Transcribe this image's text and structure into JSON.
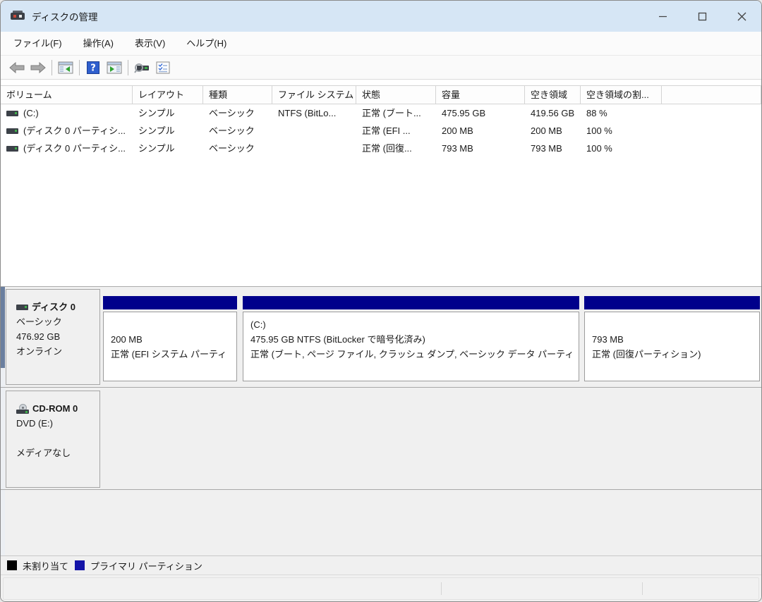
{
  "window": {
    "title": "ディスクの管理"
  },
  "menu": {
    "items": [
      "ファイル(F)",
      "操作(A)",
      "表示(V)",
      "ヘルプ(H)"
    ]
  },
  "toolbar": {
    "icons": [
      "back",
      "forward",
      "show-console-tree",
      "help",
      "show-action-pane",
      "disk-search",
      "properties"
    ]
  },
  "volume_table": {
    "columns": [
      "ボリューム",
      "レイアウト",
      "種類",
      "ファイル システム",
      "状態",
      "容量",
      "空き領域",
      "空き領域の割..."
    ],
    "rows": [
      {
        "volume": "(C:)",
        "layout": "シンプル",
        "kind": "ベーシック",
        "fs": "NTFS (BitLo...",
        "status": "正常 (ブート...",
        "capacity": "475.95 GB",
        "free": "419.56 GB",
        "pct": "88 %"
      },
      {
        "volume": "(ディスク 0 パーティシ...",
        "layout": "シンプル",
        "kind": "ベーシック",
        "fs": "",
        "status": "正常 (EFI ...",
        "capacity": "200 MB",
        "free": "200 MB",
        "pct": "100 %"
      },
      {
        "volume": "(ディスク 0 パーティシ...",
        "layout": "シンプル",
        "kind": "ベーシック",
        "fs": "",
        "status": "正常 (回復...",
        "capacity": "793 MB",
        "free": "793 MB",
        "pct": "100 %"
      }
    ]
  },
  "disk_panel": {
    "disk0": {
      "name": "ディスク 0",
      "type": "ベーシック",
      "size": "476.92 GB",
      "status": "オンライン",
      "partitions": [
        {
          "line1": "",
          "line2": "200 MB",
          "line3": "正常 (EFI システム パーティ"
        },
        {
          "line1": "(C:)",
          "line2": "475.95 GB NTFS (BitLocker で暗号化済み)",
          "line3": "正常 (ブート, ページ ファイル, クラッシュ ダンプ, ベーシック データ パーティ"
        },
        {
          "line1": "",
          "line2": "793 MB",
          "line3": "正常 (回復パーティション)"
        }
      ]
    },
    "cdrom": {
      "name": "CD-ROM 0",
      "drive": "DVD (E:)",
      "media": "メディアなし"
    }
  },
  "legend": {
    "items": [
      {
        "label": "未割り当て",
        "color": "#000000"
      },
      {
        "label": "プライマリ パーティション",
        "color": "#1414a8"
      }
    ]
  },
  "colors": {
    "titlebar": "#d6e6f5",
    "partition_header": "#00008b",
    "help_icon_bg": "#2f5fce",
    "pane_background": "#f0f0f0"
  }
}
